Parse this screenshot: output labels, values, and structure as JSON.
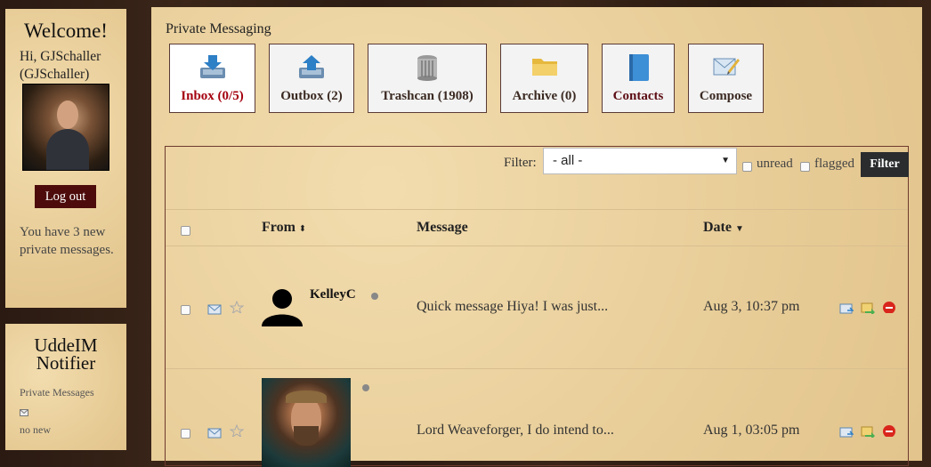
{
  "sidebar": {
    "welcome_title": "Welcome!",
    "greeting": "Hi, GJSchaller (GJSchaller)",
    "logout_label": "Log out",
    "new_messages_text": "You have 3 new private messages."
  },
  "notifier": {
    "title_line1": "UddeIM",
    "title_line2": "Notifier",
    "link": "Private Messages",
    "status": "no new"
  },
  "main": {
    "heading": "Private Messaging",
    "tabs": [
      {
        "label": "Inbox (0/5)",
        "icon": "inbox-icon"
      },
      {
        "label": "Outbox (2)",
        "icon": "outbox-icon"
      },
      {
        "label": "Trashcan (1908)",
        "icon": "trashcan-icon"
      },
      {
        "label": "Archive (0)",
        "icon": "folder-icon"
      },
      {
        "label": "Contacts",
        "icon": "contacts-book-icon"
      },
      {
        "label": "Compose",
        "icon": "compose-icon"
      }
    ],
    "filter": {
      "label": "Filter:",
      "selected": "- all -",
      "unread_label": "unread",
      "flagged_label": "flagged",
      "button": "Filter"
    },
    "columns": {
      "from": "From",
      "message": "Message",
      "date": "Date"
    },
    "rows": [
      {
        "from": "KelleyC",
        "message": "Quick message Hiya! I was just...",
        "date": "Aug 3, 10:37 pm"
      },
      {
        "from": "",
        "message": "Lord Weaveforger, I do intend to...",
        "date": "Aug 1, 03:05 pm"
      }
    ]
  },
  "colors": {
    "accent": "#a4000f",
    "button_dark": "#4d0c0b",
    "filter_button": "#2a2c2e"
  }
}
